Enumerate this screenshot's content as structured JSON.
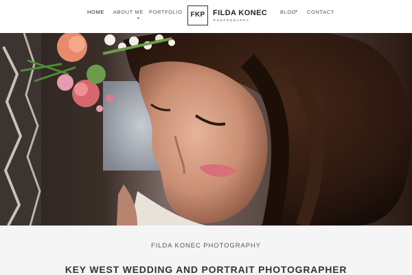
{
  "nav": {
    "items": [
      {
        "label": "HOME"
      },
      {
        "label": "ABOUT ME"
      },
      {
        "label": "PORTFOLIO"
      },
      {
        "label": "BLOG"
      },
      {
        "label": "CONTACT"
      }
    ]
  },
  "logo": {
    "mark": "FKP",
    "name": "FILDA KONEC",
    "sub": "PHOTOGRAPHY"
  },
  "footer_intro": {
    "site_name": "FILDA KONEC PHOTOGRAPHY",
    "heading": "KEY WEST WEDDING AND PORTRAIT PHOTOGRAPHER"
  },
  "colors": {
    "accent": "#333333",
    "background": "#f5f5f5",
    "header": "#ffffff"
  }
}
